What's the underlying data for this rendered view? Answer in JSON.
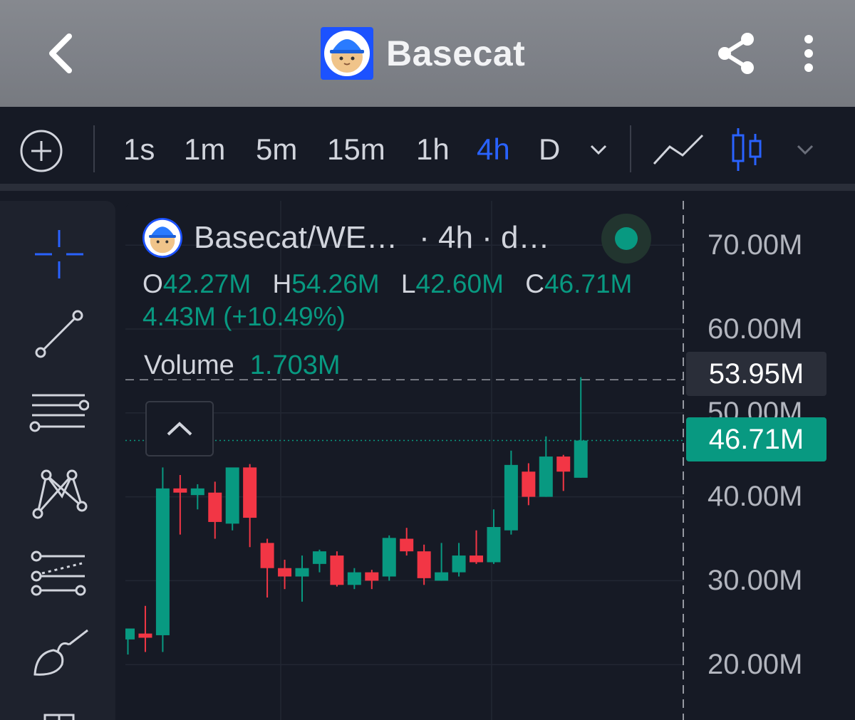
{
  "app": {
    "title": "Basecat",
    "icons": {
      "back": "chevron-left-icon",
      "share": "share-icon",
      "more": "more-vertical-icon",
      "logo": "basecat-logo"
    }
  },
  "toolbar": {
    "timeframes": [
      "1s",
      "1m",
      "5m",
      "15m",
      "1h",
      "4h",
      "D"
    ],
    "active_timeframe": "4h",
    "icons": [
      "add-circle-icon",
      "chevron-down-icon",
      "line-chart-icon",
      "candlestick-icon",
      "chevron-down-icon"
    ]
  },
  "colors": {
    "up": "#089981",
    "down": "#f23645",
    "accent": "#2962ff",
    "background": "#161a25",
    "panel": "#1e222d"
  },
  "legend": {
    "symbol": "Basecat/WE…",
    "interval_text": "· 4h · d…",
    "open_label": "O",
    "open": "42.27M",
    "high_label": "H",
    "high": "54.26M",
    "low_label": "L",
    "low": "42.60M",
    "close_label": "C",
    "close": "46.71M",
    "change": "4.43M (+10.49%)",
    "volume_label": "Volume",
    "volume": "1.703M"
  },
  "drawing_tools": [
    "crosshair-icon",
    "trend-line-icon",
    "horizontal-lines-icon",
    "pattern-icon",
    "fib-channel-icon",
    "brush-icon"
  ],
  "price_labels": {
    "crosshair": "53.95M",
    "last": "46.71M"
  },
  "chart_data": {
    "type": "candlestick",
    "y_ticks": [
      "70.00M",
      "60.00M",
      "50.00M",
      "40.00M",
      "30.00M",
      "20.00M"
    ],
    "ylim": [
      17.0,
      74.0
    ],
    "grid": true,
    "crosshair_price": 53.95,
    "last_price": 46.71,
    "candles": [
      {
        "o": 23.0,
        "h": 24.0,
        "l": 21.2,
        "c": 24.3
      },
      {
        "o": 23.7,
        "h": 27.0,
        "l": 21.5,
        "c": 23.2
      },
      {
        "o": 23.5,
        "h": 43.5,
        "l": 21.5,
        "c": 41.0
      },
      {
        "o": 41.0,
        "h": 42.6,
        "l": 35.5,
        "c": 40.5
      },
      {
        "o": 40.2,
        "h": 41.5,
        "l": 38.5,
        "c": 41.0
      },
      {
        "o": 40.5,
        "h": 41.8,
        "l": 35.0,
        "c": 37.0
      },
      {
        "o": 36.8,
        "h": 41.8,
        "l": 36.0,
        "c": 43.5
      },
      {
        "o": 43.5,
        "h": 43.9,
        "l": 34.0,
        "c": 37.5
      },
      {
        "o": 34.5,
        "h": 35.0,
        "l": 28.0,
        "c": 31.5
      },
      {
        "o": 31.5,
        "h": 32.5,
        "l": 29.0,
        "c": 30.5
      },
      {
        "o": 30.5,
        "h": 33.0,
        "l": 27.5,
        "c": 31.5
      },
      {
        "o": 32.0,
        "h": 33.7,
        "l": 31.0,
        "c": 33.5
      },
      {
        "o": 33.0,
        "h": 33.5,
        "l": 29.3,
        "c": 29.5
      },
      {
        "o": 29.5,
        "h": 31.5,
        "l": 29.0,
        "c": 31.0
      },
      {
        "o": 31.0,
        "h": 31.3,
        "l": 29.0,
        "c": 30.0
      },
      {
        "o": 30.5,
        "h": 35.4,
        "l": 30.0,
        "c": 35.1
      },
      {
        "o": 35.0,
        "h": 36.3,
        "l": 33.0,
        "c": 33.5
      },
      {
        "o": 33.5,
        "h": 34.3,
        "l": 29.5,
        "c": 30.3
      },
      {
        "o": 30.0,
        "h": 34.5,
        "l": 30.0,
        "c": 31.0
      },
      {
        "o": 31.0,
        "h": 34.5,
        "l": 30.5,
        "c": 33.0
      },
      {
        "o": 33.0,
        "h": 36.0,
        "l": 32.0,
        "c": 32.2
      },
      {
        "o": 32.2,
        "h": 38.5,
        "l": 32.0,
        "c": 36.4
      },
      {
        "o": 36.0,
        "h": 45.5,
        "l": 35.5,
        "c": 43.8
      },
      {
        "o": 43.0,
        "h": 44.0,
        "l": 39.0,
        "c": 40.0
      },
      {
        "o": 40.0,
        "h": 47.2,
        "l": 40.0,
        "c": 44.8
      },
      {
        "o": 44.8,
        "h": 45.0,
        "l": 40.7,
        "c": 43.0
      },
      {
        "o": 42.27,
        "h": 54.26,
        "l": 42.6,
        "c": 46.71
      }
    ]
  }
}
